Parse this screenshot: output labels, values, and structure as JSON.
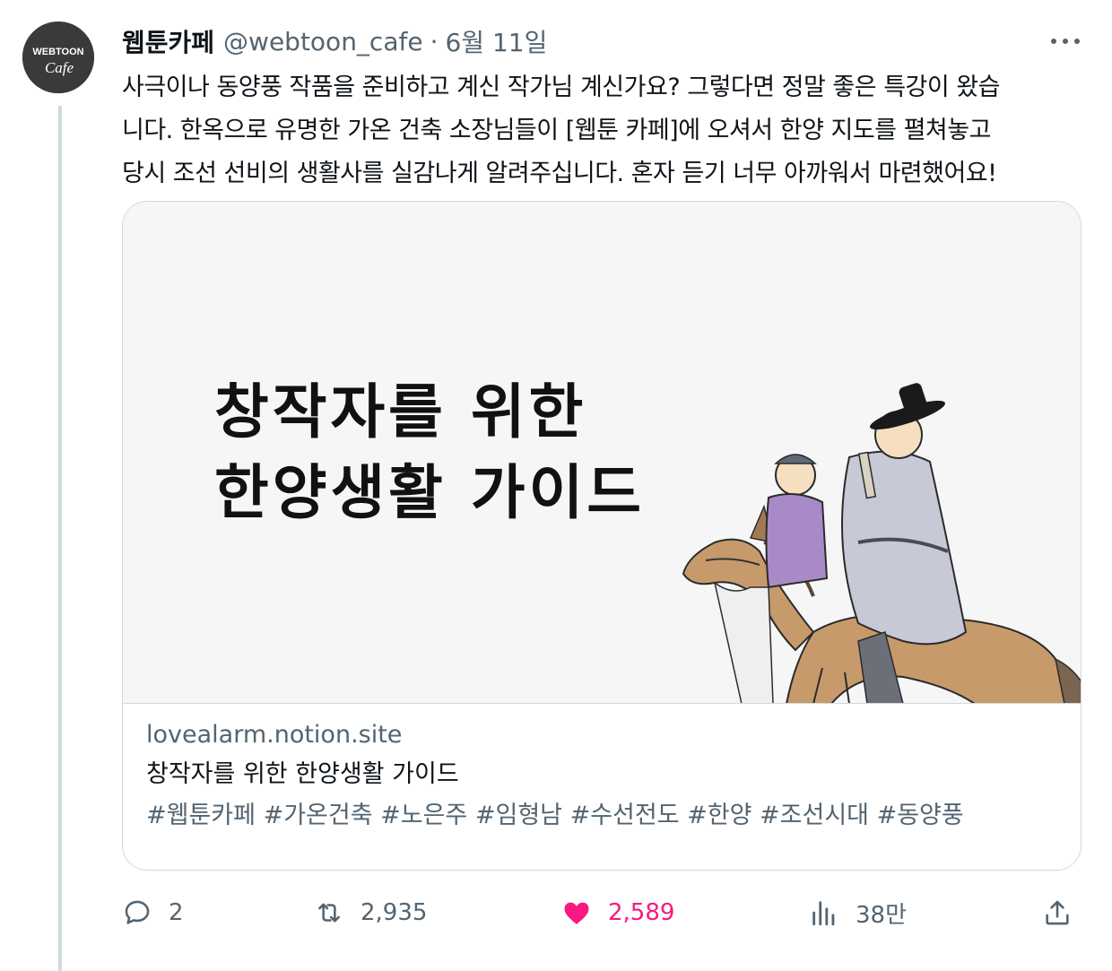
{
  "tweet": {
    "display_name": "웹툰카페",
    "handle": "@webtoon_cafe",
    "separator": "·",
    "date": "6월 11일",
    "text_lines": [
      "사극이나 동양풍 작품을 준비하고 계신 작가님 계신가요? 그렇다면 정말 좋은 특강이 왔습",
      "니다. 한옥으로 유명한 가온 건축 소장님들이 [웹툰 카페]에 오셔서 한양 지도를 펼쳐놓고",
      "당시 조선 선비의 생활사를 실감나게 알려주십니다.  혼자 듣기 너무 아까워서 마련했어요!"
    ]
  },
  "avatar": {
    "line1": "WEBTOON",
    "line2": "Cafe"
  },
  "card": {
    "image_title_line1": "창작자를 위한",
    "image_title_line2": "한양생활 가이드",
    "domain": "lovealarm.notion.site",
    "title": "창작자를 위한 한양생활 가이드",
    "tags": "#웹툰카페 #가온건축 #노은주 #임형남 #수선전도 #한양 #조선시대 #동양풍"
  },
  "actions": {
    "replies": "2",
    "retweets": "2,935",
    "likes": "2,589",
    "views": "38만"
  },
  "colors": {
    "text": "#0f1419",
    "secondary": "#536471",
    "like": "#f91880",
    "border": "#cfd9de"
  },
  "icons": {
    "reply": "speech-bubble-icon",
    "retweet": "retweet-arrows-icon",
    "like": "heart-icon",
    "views": "bar-chart-icon",
    "share": "share-upload-icon",
    "more": "more-dots-icon"
  }
}
